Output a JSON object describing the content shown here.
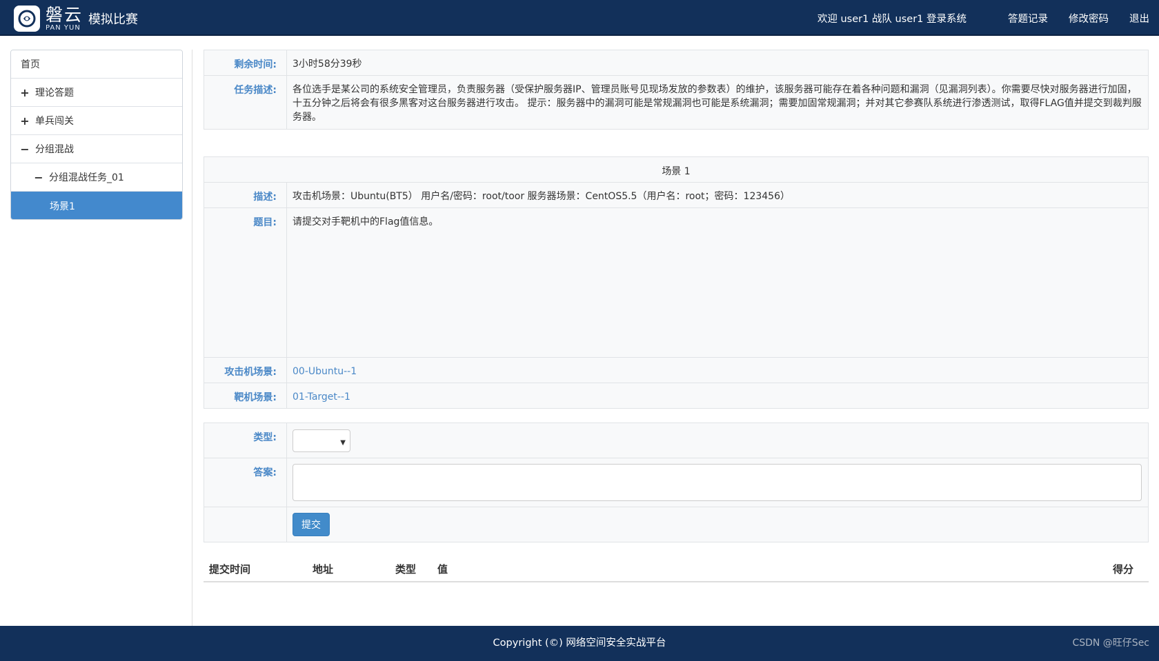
{
  "header": {
    "logo_cn": "磐云",
    "logo_en": "PAN YUN",
    "title": "模拟比赛",
    "welcome": "欢迎 user1 战队 user1 登录系统",
    "links": [
      "答题记录",
      "修改密码",
      "退出"
    ]
  },
  "sidebar": {
    "items": [
      {
        "label": "首页",
        "symbol": ""
      },
      {
        "label": "理论答题",
        "symbol": "+"
      },
      {
        "label": "单兵闯关",
        "symbol": "+"
      },
      {
        "label": "分组混战",
        "symbol": "−"
      },
      {
        "label": "分组混战任务_01",
        "symbol": "−"
      },
      {
        "label": "场景1",
        "symbol": ""
      }
    ]
  },
  "info": {
    "remaining_label": "剩余时间:",
    "remaining_value": "3小时58分39秒",
    "task_label": "任务描述:",
    "task_value": "各位选手是某公司的系统安全管理员，负责服务器（受保护服务器IP、管理员账号见现场发放的参数表）的维护，该服务器可能存在着各种问题和漏洞（见漏洞列表）。你需要尽快对服务器进行加固，十五分钟之后将会有很多黑客对这台服务器进行攻击。 提示：服务器中的漏洞可能是常规漏洞也可能是系统漏洞；需要加固常规漏洞；并对其它参赛队系统进行渗透测试，取得FLAG值并提交到裁判服务器。"
  },
  "scene": {
    "title": "场景 1",
    "desc_label": "描述:",
    "desc_value": "攻击机场景：Ubuntu(BT5） 用户名/密码：root/toor 服务器场景：CentOS5.5（用户名：root；密码：123456）",
    "question_label": "题目:",
    "question_value": "请提交对手靶机中的Flag值信息。",
    "attack_label": "攻击机场景:",
    "attack_value": "00-Ubuntu--1",
    "target_label": "靶机场景:",
    "target_value": "01-Target--1"
  },
  "form": {
    "type_label": "类型:",
    "type_value": "",
    "answer_label": "答案:",
    "answer_value": "",
    "submit_label": "提交"
  },
  "results": {
    "columns": [
      "提交时间",
      "地址",
      "类型",
      "值",
      "得分"
    ]
  },
  "footer": {
    "copyright": "Copyright (©) 网络空间安全实战平台",
    "watermark": "CSDN @旺仔Sec"
  }
}
